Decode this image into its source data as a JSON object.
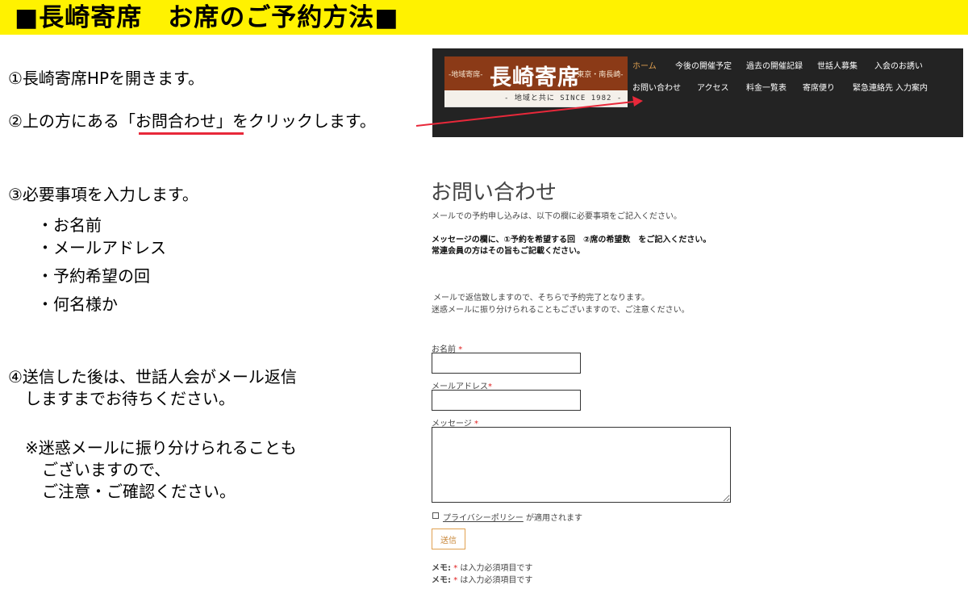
{
  "banner": {
    "title": "■長崎寄席　お席のご予約方法■"
  },
  "instructions": {
    "step1": "①長崎寄席HPを開きます。",
    "step2_before": "②上の方にある",
    "step2_highlight": "「お問合わせ」",
    "step2_after": "をクリックします。",
    "step3": "③必要事項を入力します。",
    "bullets": [
      "・お名前",
      "・メールアドレス",
      "・予約希望の回",
      "・何名様か"
    ],
    "step4_line1": "④送信した後は、世話人会がメール返信",
    "step4_line2": "しますまでお待ちください。",
    "note_line1": "※迷惑メールに振り分けられることも",
    "note_line2": "ございますので、",
    "note_line3": "ご注意・ご確認ください。"
  },
  "site": {
    "logo": {
      "left_text": "-地域寄席-",
      "main_text": "長崎寄席",
      "right_text": "-東京・南長崎-",
      "since_text": "-  地域と共に  SINCE  1982  -"
    },
    "nav_row1": [
      "ホーム",
      "今後の開催予定",
      "過去の開催記録",
      "世話人募集",
      "入会のお誘い"
    ],
    "nav_row2": [
      "お問い合わせ",
      "アクセス",
      "料金一覧表",
      "寄席便り",
      "緊急連絡先",
      "入力案内"
    ],
    "active_nav": "ホーム",
    "accent_color": "#e0a050"
  },
  "form": {
    "title": "お問い合わせ",
    "intro": "メールでの予約申し込みは、以下の欄に必要事項をご記入ください。",
    "bold_line1": "メッセージの欄に、①予約を希望する回　②席の希望数　をご記入ください。",
    "bold_line2": "常連会員の方はその旨もご記載ください。",
    "info_line1": "メールで返信致しますので、そちらで予約完了となります。",
    "info_line2": "迷惑メールに振り分けられることもございますので、ご注意ください。",
    "name_label": "お名前",
    "email_label": "メールアドレス",
    "message_label": "メッセージ",
    "required_mark": "*",
    "name_value": "",
    "email_value": "",
    "message_value": "",
    "privacy_link": "プライバシーポリシー",
    "privacy_suffix": "が適用されます",
    "submit_label": "送信",
    "memo_label": "メモ:",
    "memo_text": "は入力必須項目です"
  }
}
